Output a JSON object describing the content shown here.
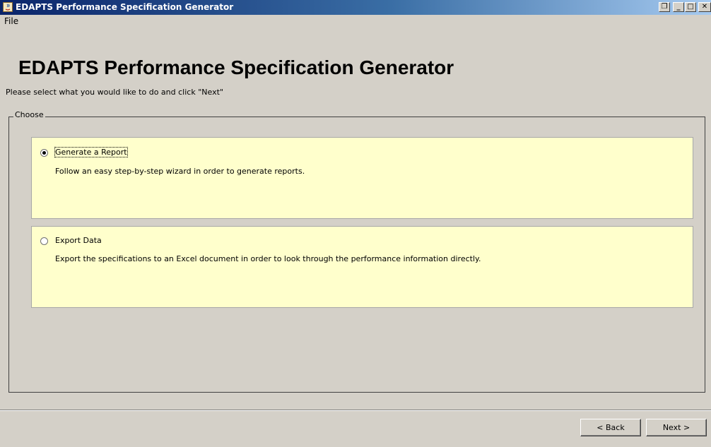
{
  "window": {
    "title": "EDAPTS Performance Specification Generator",
    "controls": {
      "restore_icon": "restore-icon",
      "minimize_icon": "minimize-icon",
      "maximize_icon": "maximize-icon",
      "close_icon": "close-icon"
    }
  },
  "menu": {
    "items": [
      {
        "label": "File"
      }
    ]
  },
  "header": {
    "title": "EDAPTS Performance Specification Generator",
    "instructions": "Please select what you would like to do and click \"Next\""
  },
  "choose_group": {
    "label": "Choose",
    "options": [
      {
        "label": "Generate a Report",
        "description": "Follow an easy step-by-step wizard in order to generate reports.",
        "selected": true
      },
      {
        "label": "Export Data",
        "description": "Export the specifications to an Excel document in order to look through the performance information directly.",
        "selected": false
      }
    ]
  },
  "footer": {
    "back_label": "< Back",
    "next_label": "Next >"
  },
  "colors": {
    "titlebar_start": "#0a246a",
    "option_background": "#ffffcc",
    "window_background": "#d4d0c8"
  }
}
